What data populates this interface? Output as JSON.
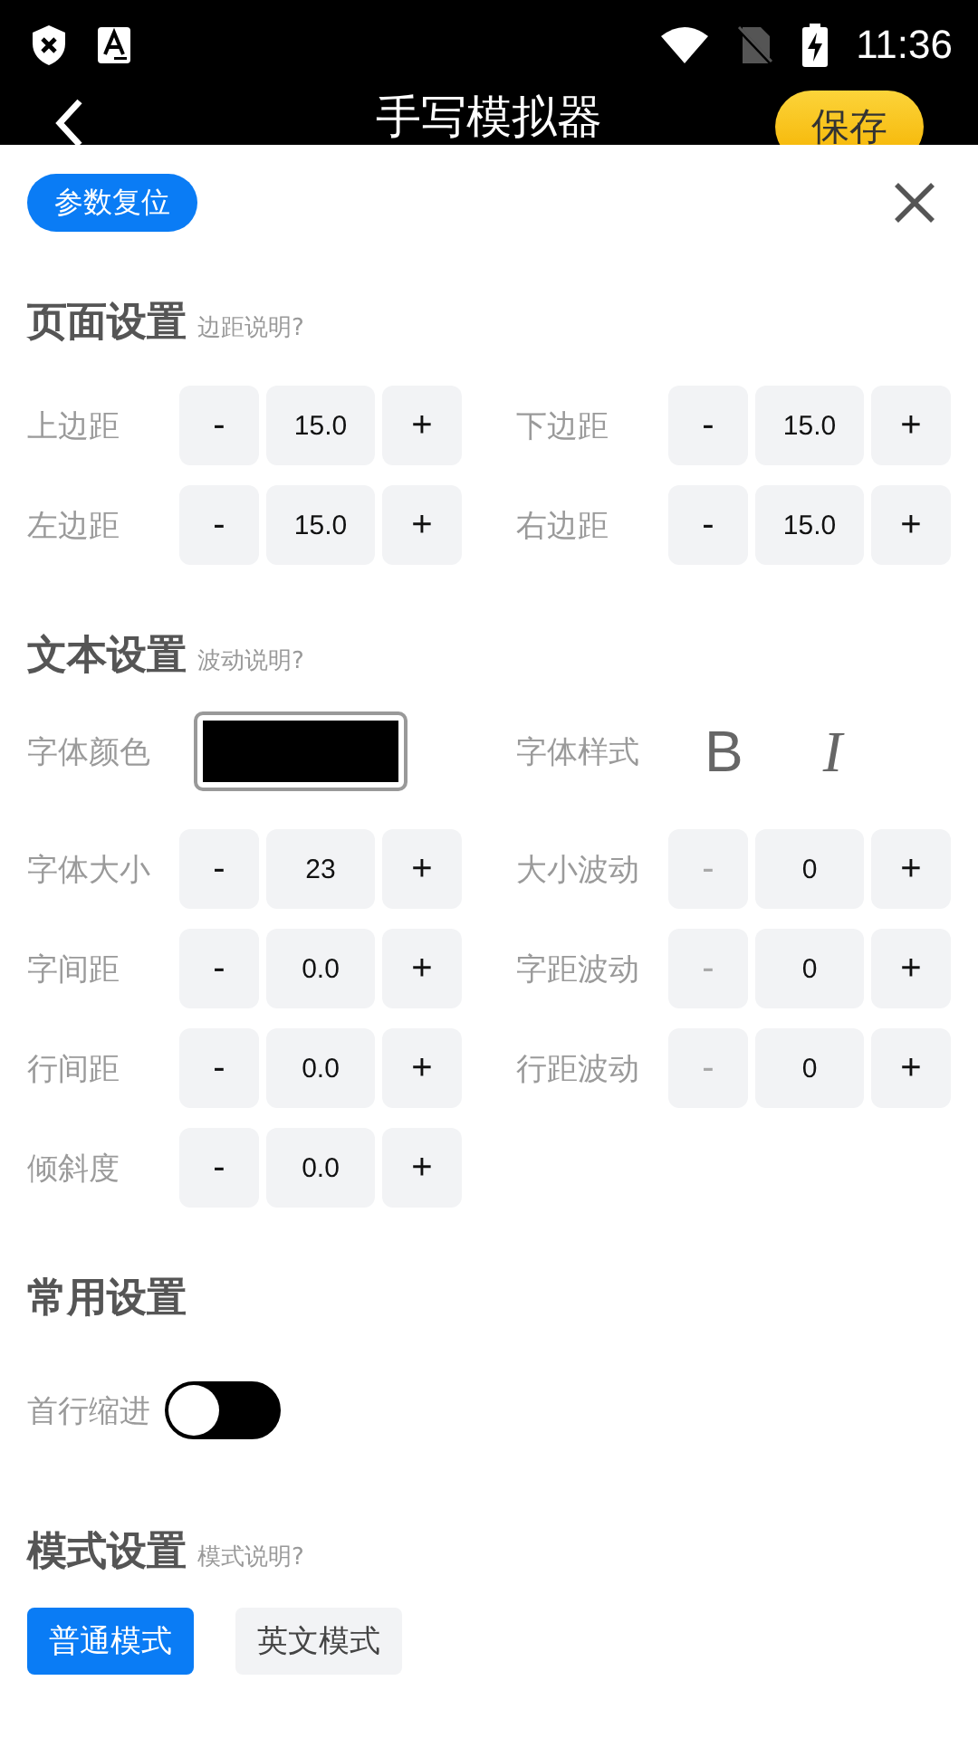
{
  "status_bar": {
    "time": "11:36"
  },
  "app_bar": {
    "title": "手写模拟器",
    "save": "保存"
  },
  "reset": "参数复位",
  "sections": [
    {
      "title": "页面设置",
      "hint": "边距说明?",
      "items": [
        {
          "kind": "stepper",
          "label": "上边距",
          "minus": "-",
          "value": "15.0",
          "plus": "+",
          "minus_disabled": false
        },
        {
          "kind": "stepper",
          "label": "下边距",
          "minus": "-",
          "value": "15.0",
          "plus": "+",
          "minus_disabled": false
        },
        {
          "kind": "stepper",
          "label": "左边距",
          "minus": "-",
          "value": "15.0",
          "plus": "+",
          "minus_disabled": false
        },
        {
          "kind": "stepper",
          "label": "右边距",
          "minus": "-",
          "value": "15.0",
          "plus": "+",
          "minus_disabled": false
        }
      ]
    },
    {
      "title": "文本设置",
      "hint": "波动说明?",
      "items": [
        {
          "kind": "color",
          "label": "字体颜色",
          "color": "#000000"
        },
        {
          "kind": "font_style",
          "label": "字体样式",
          "bold": "B",
          "italic": "I"
        },
        {
          "kind": "stepper",
          "label": "字体大小",
          "minus": "-",
          "value": "23",
          "plus": "+",
          "minus_disabled": false
        },
        {
          "kind": "stepper",
          "label": "大小波动",
          "minus": "-",
          "value": "0",
          "plus": "+",
          "minus_disabled": true
        },
        {
          "kind": "stepper",
          "label": "字间距",
          "minus": "-",
          "value": "0.0",
          "plus": "+",
          "minus_disabled": false
        },
        {
          "kind": "stepper",
          "label": "字距波动",
          "minus": "-",
          "value": "0",
          "plus": "+",
          "minus_disabled": true
        },
        {
          "kind": "stepper",
          "label": "行间距",
          "minus": "-",
          "value": "0.0",
          "plus": "+",
          "minus_disabled": false
        },
        {
          "kind": "stepper",
          "label": "行距波动",
          "minus": "-",
          "value": "0",
          "plus": "+",
          "minus_disabled": true
        },
        {
          "kind": "stepper",
          "label": "倾斜度",
          "minus": "-",
          "value": "0.0",
          "plus": "+",
          "minus_disabled": false
        }
      ]
    },
    {
      "title": "常用设置",
      "items": [
        {
          "kind": "toggle",
          "label": "首行缩进",
          "on": false
        }
      ]
    },
    {
      "title": "模式设置",
      "hint": "模式说明?",
      "modes": [
        {
          "label": "普通模式",
          "selected": true
        },
        {
          "label": "英文模式",
          "selected": false
        }
      ]
    }
  ]
}
